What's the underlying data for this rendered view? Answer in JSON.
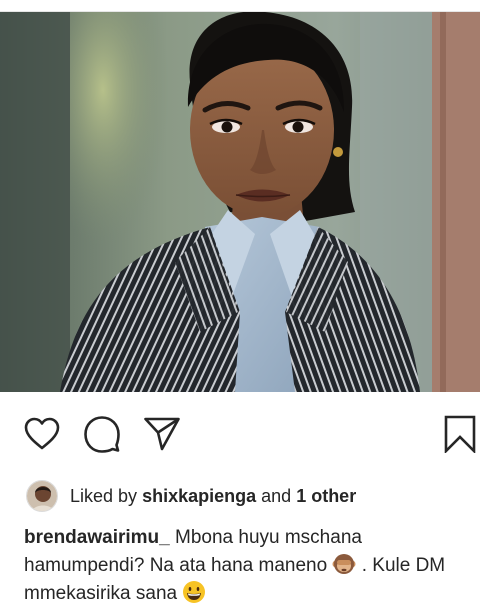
{
  "post": {
    "image_alt": "Woman in pinstripe blazer and light blue collared shirt"
  },
  "actions": {
    "like_icon": "heart-outline-icon",
    "comment_icon": "comment-bubble-icon",
    "share_icon": "paper-plane-icon",
    "save_icon": "bookmark-outline-icon"
  },
  "likes": {
    "prefix": "Liked by",
    "user": "shixkapienga",
    "and": "and",
    "others": "1 other"
  },
  "caption": {
    "username": "brendawairimu_",
    "text_1": "Mbona huyu mschana hamumpendi? Na ata hana maneno",
    "emoji_1": "see-no-evil-monkey-emoji",
    "text_2": ". Kule DM mmekasirika sana",
    "emoji_2": "grinning-face-emoji"
  },
  "colors": {
    "text": "#262626",
    "icon_stroke": "#262626",
    "divider": "#e6e6e6"
  }
}
